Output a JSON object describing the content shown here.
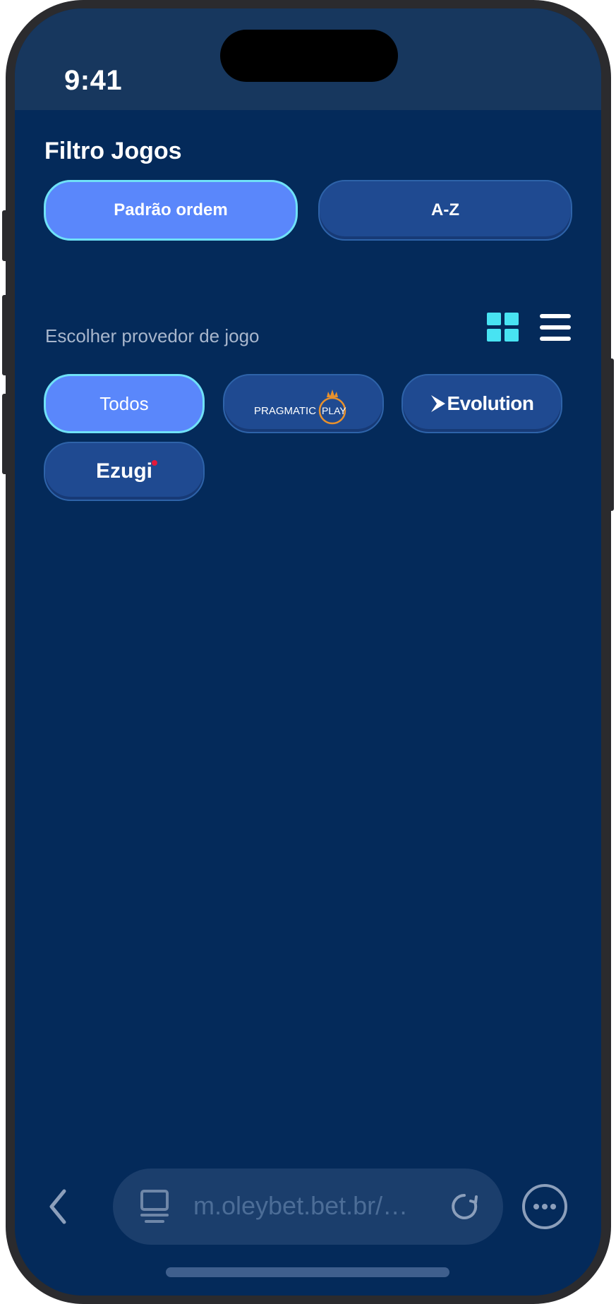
{
  "status_bar": {
    "time": "9:41"
  },
  "filter": {
    "title": "Filtro Jogos",
    "sort_options": [
      {
        "label": "Padrão ordem",
        "active": true
      },
      {
        "label": "A-Z",
        "active": false
      }
    ]
  },
  "providers": {
    "label": "Escolher provedor de jogo",
    "view_modes": {
      "grid_icon": "grid-icon",
      "list_icon": "list-icon",
      "active": "grid"
    },
    "items": [
      {
        "label": "Todos",
        "active": true
      },
      {
        "label": "PRAGMATIC PLAY",
        "logo_text": "PRAGMATIC",
        "logo_text_2": "PLAY",
        "active": false
      },
      {
        "label": "Evolution",
        "active": false
      },
      {
        "label": "Ezugi",
        "active": false
      }
    ]
  },
  "browser": {
    "back_icon": "chevron-left-icon",
    "tabs_icon": "tabs-icon",
    "url": "m.oleybet.bet.br/…",
    "reload_icon": "reload-icon",
    "more_icon": "more-icon"
  },
  "colors": {
    "background": "#042a5a",
    "status_bar": "#17375e",
    "active_pill": "#5a87fb",
    "active_border": "#6fe1f7",
    "inactive_pill": "#1f4a91",
    "accent_icon": "#48e3f2",
    "pragmatic_orange": "#e8912d",
    "ezugi_dot": "#e4193b"
  }
}
